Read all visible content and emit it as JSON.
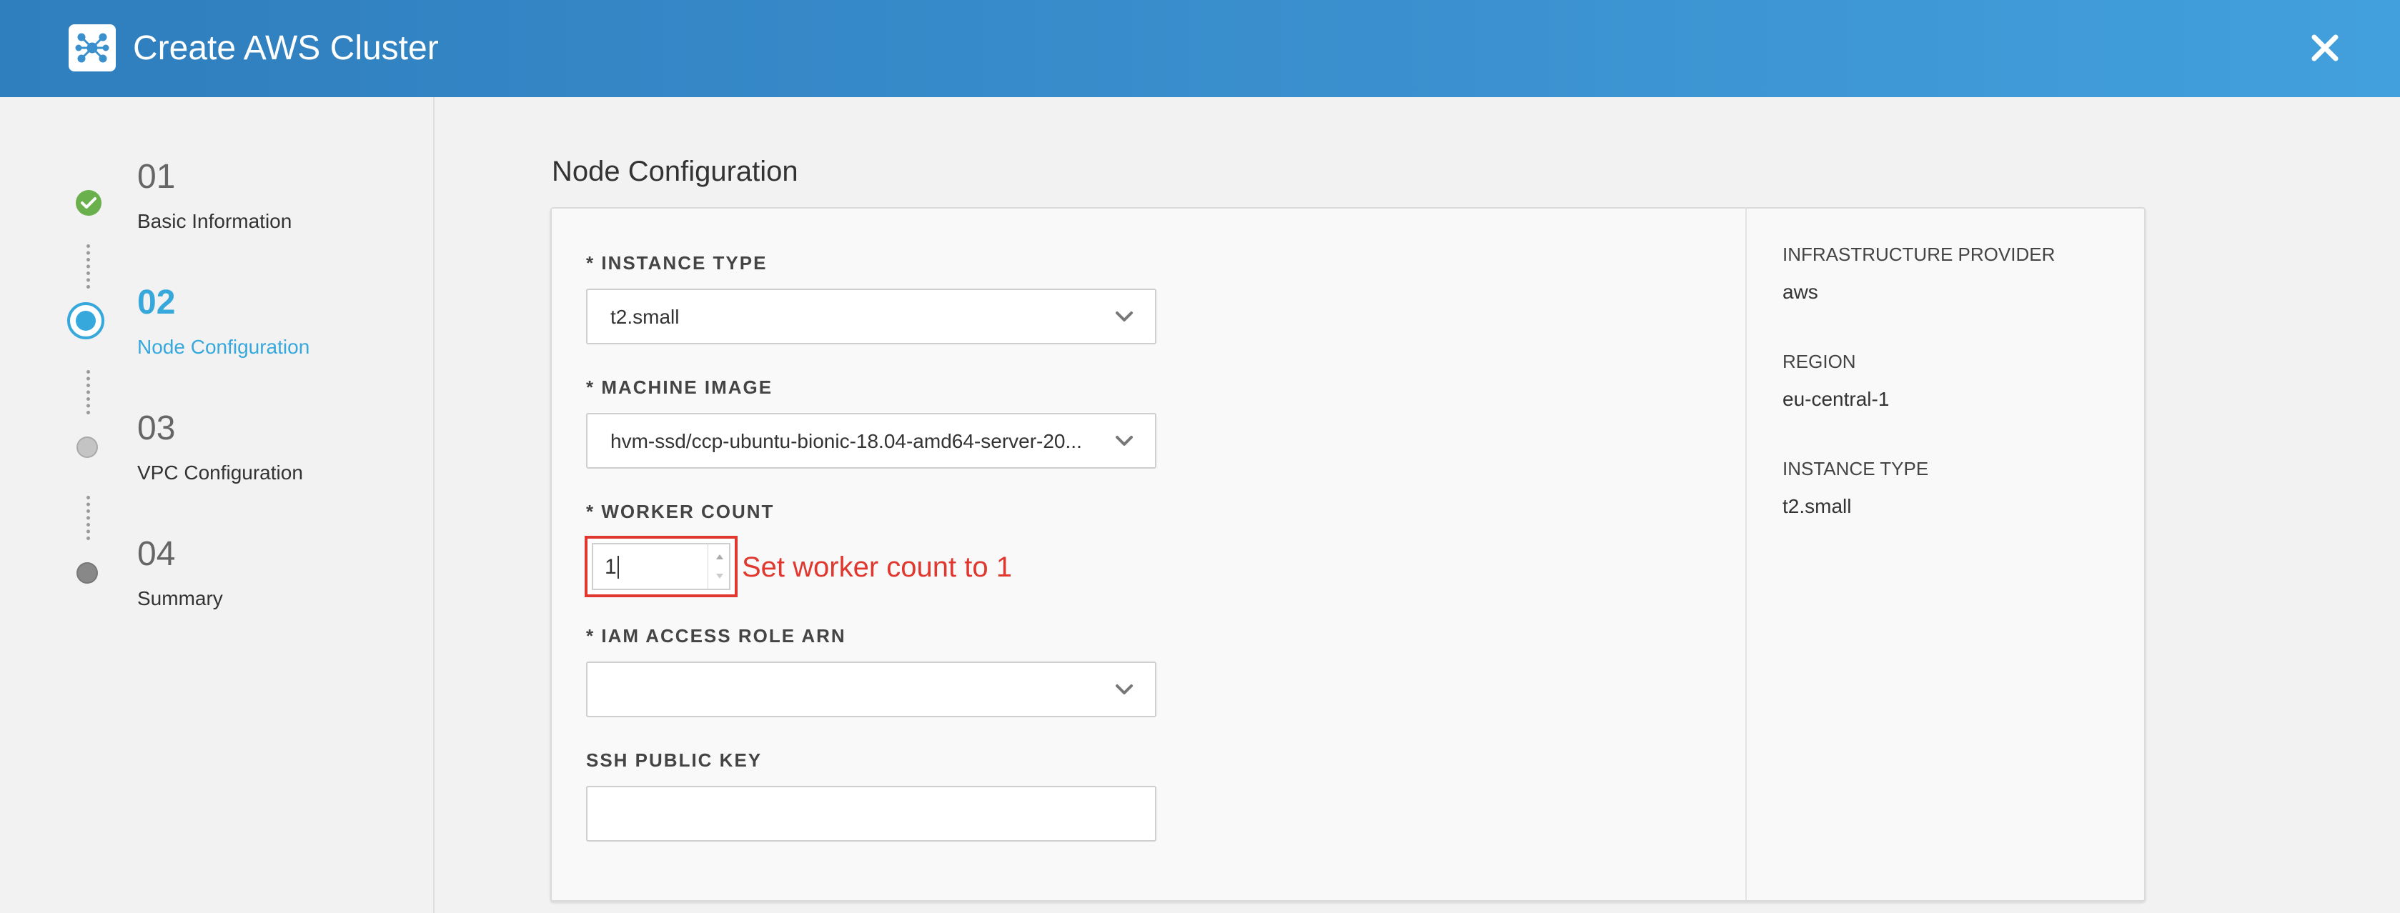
{
  "header": {
    "title": "Create AWS Cluster",
    "background_color": "#3a8fcd",
    "logo_icon": "cluster-icon",
    "close_icon": "close-icon"
  },
  "steps": [
    {
      "number": "01",
      "label": "Basic Information",
      "state": "completed"
    },
    {
      "number": "02",
      "label": "Node Configuration",
      "state": "active"
    },
    {
      "number": "03",
      "label": "VPC Configuration",
      "state": "pending"
    },
    {
      "number": "04",
      "label": "Summary",
      "state": "pending"
    }
  ],
  "main": {
    "section_title": "Node Configuration",
    "fields": {
      "instance_type": {
        "label": "* INSTANCE TYPE",
        "value": "t2.small"
      },
      "machine_image": {
        "label": "* MACHINE IMAGE",
        "value": "hvm-ssd/ccp-ubuntu-bionic-18.04-amd64-server-20..."
      },
      "worker_count": {
        "label": "* WORKER COUNT",
        "value": "1"
      },
      "iam_role": {
        "label": "* IAM ACCESS ROLE ARN",
        "value": ""
      },
      "ssh_key": {
        "label": "SSH PUBLIC KEY",
        "value": ""
      }
    },
    "annotation": {
      "text": "Set worker count to 1",
      "color": "#e0382f"
    }
  },
  "summary": {
    "infrastructure_provider_label": "INFRASTRUCTURE PROVIDER",
    "infrastructure_provider_value": "aws",
    "region_label": "REGION",
    "region_value": "eu-central-1",
    "instance_type_label": "INSTANCE TYPE",
    "instance_type_value": "t2.small"
  },
  "colors": {
    "accent": "#37a8dc",
    "success": "#6ab04c",
    "highlight": "#e0382f"
  }
}
